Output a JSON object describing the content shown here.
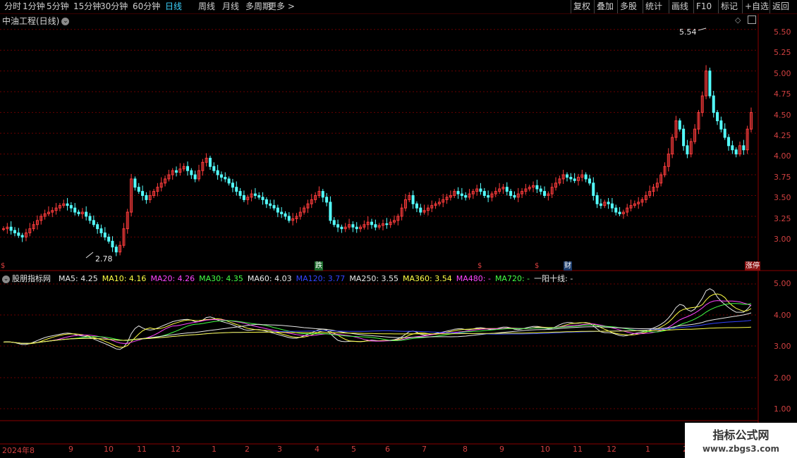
{
  "toolbar": {
    "periods": [
      "分时",
      "1分钟",
      "5分钟",
      "15分钟",
      "30分钟",
      "60分钟",
      "日线",
      "周线",
      "月线",
      "多周期",
      "更多 >"
    ],
    "active_period": "日线",
    "right_buttons": [
      "复权",
      "叠加",
      "多股",
      "统计",
      "画线",
      "F10",
      "标记",
      "+自选",
      "返回"
    ]
  },
  "main_chart": {
    "title": "中油工程(日线)",
    "high_marker": "5.54",
    "low_marker": "2.78",
    "y_ticks": [
      "5.50",
      "5.25",
      "5.00",
      "4.75",
      "4.50",
      "4.25",
      "4.00",
      "3.75",
      "3.50",
      "3.25",
      "3.00"
    ],
    "event_tags": [
      {
        "text": "跌",
        "color": "#22b14c"
      },
      {
        "text": "$",
        "color": "#e04040"
      },
      {
        "text": "$",
        "color": "#e04040"
      },
      {
        "text": "财",
        "color": "#4a90e2"
      },
      {
        "text": "涨停",
        "color": "#e04040"
      },
      {
        "text": "$",
        "color": "#e04040"
      }
    ]
  },
  "indicator_panel": {
    "name": "股朋指标网",
    "legend": [
      {
        "text": "MA5: 4.25",
        "color": "#e8e8e8"
      },
      {
        "text": "MA10: 4.16",
        "color": "#ffff44"
      },
      {
        "text": "MA20: 4.26",
        "color": "#ff44ff"
      },
      {
        "text": "MA30: 4.35",
        "color": "#44ff44"
      },
      {
        "text": "MA60: 4.03",
        "color": "#e8e8e8"
      },
      {
        "text": "MA120: 3.77",
        "color": "#3344ff"
      },
      {
        "text": "MA250: 3.55",
        "color": "#e8e8e8"
      },
      {
        "text": "MA360: 3.54",
        "color": "#ffff44"
      },
      {
        "text": "MA480: -",
        "color": "#ff44ff"
      },
      {
        "text": "MA720: -",
        "color": "#44ff44"
      },
      {
        "text": "一阳十线: -",
        "color": "#e8e8e8"
      }
    ],
    "y_ticks": [
      "5.00",
      "4.00",
      "3.00",
      "2.00",
      "1.00"
    ]
  },
  "date_axis": [
    "2024年8",
    "9",
    "10",
    "11",
    "12",
    "1",
    "2",
    "3",
    "4",
    "5",
    "6",
    "7",
    "8",
    "9",
    "10",
    "11",
    "12",
    "1",
    "2"
  ],
  "watermark": {
    "line1": "指标公式网",
    "line2": "www.zbgs3.com"
  },
  "chart_data": {
    "type": "candlestick",
    "ylim": [
      2.8,
      5.6
    ],
    "close": [
      3.1,
      3.12,
      3.08,
      3.05,
      3.02,
      3.0,
      3.05,
      3.1,
      3.15,
      3.2,
      3.25,
      3.28,
      3.3,
      3.32,
      3.35,
      3.38,
      3.4,
      3.38,
      3.35,
      3.3,
      3.28,
      3.3,
      3.25,
      3.2,
      3.15,
      3.1,
      3.05,
      3.0,
      2.95,
      2.88,
      2.82,
      2.9,
      3.1,
      3.3,
      3.7,
      3.6,
      3.55,
      3.5,
      3.45,
      3.5,
      3.55,
      3.6,
      3.65,
      3.7,
      3.75,
      3.8,
      3.78,
      3.82,
      3.85,
      3.8,
      3.75,
      3.7,
      3.8,
      3.9,
      3.95,
      3.85,
      3.8,
      3.75,
      3.72,
      3.7,
      3.65,
      3.6,
      3.55,
      3.5,
      3.45,
      3.48,
      3.52,
      3.5,
      3.48,
      3.45,
      3.4,
      3.38,
      3.35,
      3.3,
      3.28,
      3.25,
      3.2,
      3.22,
      3.25,
      3.3,
      3.35,
      3.4,
      3.45,
      3.5,
      3.55,
      3.48,
      3.42,
      3.2,
      3.15,
      3.12,
      3.1,
      3.12,
      3.15,
      3.12,
      3.1,
      3.12,
      3.15,
      3.18,
      3.15,
      3.12,
      3.14,
      3.16,
      3.15,
      3.18,
      3.2,
      3.25,
      3.35,
      3.45,
      3.5,
      3.4,
      3.35,
      3.3,
      3.32,
      3.35,
      3.38,
      3.4,
      3.42,
      3.45,
      3.48,
      3.5,
      3.55,
      3.52,
      3.5,
      3.48,
      3.52,
      3.55,
      3.58,
      3.55,
      3.5,
      3.48,
      3.52,
      3.55,
      3.58,
      3.6,
      3.55,
      3.5,
      3.48,
      3.52,
      3.55,
      3.58,
      3.6,
      3.62,
      3.58,
      3.55,
      3.5,
      3.52,
      3.6,
      3.65,
      3.7,
      3.75,
      3.72,
      3.7,
      3.68,
      3.72,
      3.75,
      3.7,
      3.65,
      3.5,
      3.4,
      3.38,
      3.42,
      3.4,
      3.35,
      3.3,
      3.28,
      3.3,
      3.35,
      3.38,
      3.4,
      3.42,
      3.45,
      3.5,
      3.55,
      3.6,
      3.65,
      3.75,
      3.85,
      4.0,
      4.2,
      4.4,
      4.3,
      4.1,
      4.0,
      4.15,
      4.3,
      4.5,
      4.7,
      5.0,
      4.7,
      4.5,
      4.4,
      4.3,
      4.2,
      4.1,
      4.05,
      4.0,
      4.1,
      4.05,
      4.3,
      4.5
    ]
  }
}
